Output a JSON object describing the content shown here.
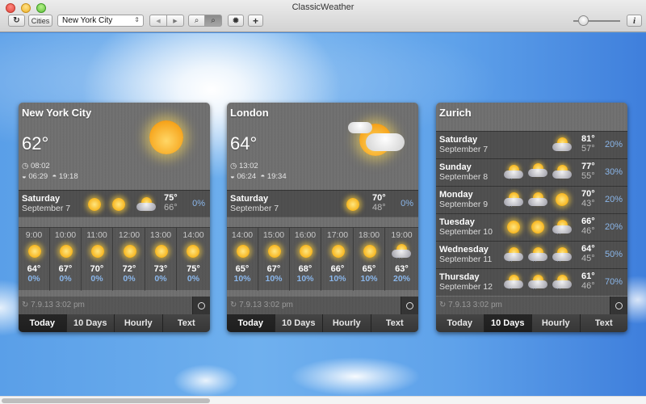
{
  "window": {
    "title": "ClassicWeather"
  },
  "toolbar": {
    "refresh_icon": "refresh-icon",
    "cities_label": "Cities",
    "city_select_value": "New York City",
    "back_icon": "◀",
    "forward_icon": "▶",
    "zoom_in_icon": "zoom-in-icon",
    "zoom_out_icon": "zoom-out-icon",
    "settings_icon": "gear-icon",
    "add_icon": "+",
    "info_icon": "i",
    "size_slider_value": 0.2
  },
  "widgets": [
    {
      "city": "New York City",
      "temp": "62°",
      "local_time": "08:02",
      "sunrise": "06:29",
      "sunset": "19:18",
      "condition_icon": "sunny-icon",
      "today": {
        "day": "Saturday",
        "date": "September 7",
        "hi": "75°",
        "lo": "66°",
        "precip": "0%",
        "icons": [
          "sunny",
          "sunny",
          "partly-cloudy"
        ]
      },
      "hourly": [
        {
          "time": "9:00",
          "temp": "64°",
          "precip": "0%",
          "icon": "sunny"
        },
        {
          "time": "10:00",
          "temp": "67°",
          "precip": "0%",
          "icon": "sunny"
        },
        {
          "time": "11:00",
          "temp": "70°",
          "precip": "0%",
          "icon": "sunny"
        },
        {
          "time": "12:00",
          "temp": "72°",
          "precip": "0%",
          "icon": "sunny"
        },
        {
          "time": "13:00",
          "temp": "73°",
          "precip": "0%",
          "icon": "sunny"
        },
        {
          "time": "14:00",
          "temp": "75°",
          "precip": "0%",
          "icon": "sunny"
        }
      ],
      "updated": "7.9.13 3:02 pm",
      "active_tab": "Today"
    },
    {
      "city": "London",
      "temp": "64°",
      "local_time": "13:02",
      "sunrise": "06:24",
      "sunset": "19:34",
      "condition_icon": "partly-cloudy-icon",
      "today": {
        "day": "Saturday",
        "date": "September 7",
        "hi": "70°",
        "lo": "48°",
        "precip": "0%",
        "icons": [
          "sunny"
        ]
      },
      "hourly": [
        {
          "time": "14:00",
          "temp": "65°",
          "precip": "10%",
          "icon": "sunny"
        },
        {
          "time": "15:00",
          "temp": "67°",
          "precip": "10%",
          "icon": "sunny"
        },
        {
          "time": "16:00",
          "temp": "68°",
          "precip": "10%",
          "icon": "sunny"
        },
        {
          "time": "17:00",
          "temp": "66°",
          "precip": "10%",
          "icon": "sunny"
        },
        {
          "time": "18:00",
          "temp": "65°",
          "precip": "10%",
          "icon": "sunny"
        },
        {
          "time": "19:00",
          "temp": "63°",
          "precip": "20%",
          "icon": "showers"
        }
      ],
      "updated": "7.9.13 3:02 pm",
      "active_tab": "Today"
    },
    {
      "city": "Zurich",
      "days": [
        {
          "day": "Saturday",
          "date": "September 7",
          "hi": "81°",
          "lo": "57°",
          "precip": "20%",
          "icons": [
            "showers"
          ]
        },
        {
          "day": "Sunday",
          "date": "September 8",
          "hi": "77°",
          "lo": "55°",
          "precip": "30%",
          "icons": [
            "showers",
            "partly-cloudy",
            "showers"
          ]
        },
        {
          "day": "Monday",
          "date": "September 9",
          "hi": "70°",
          "lo": "43°",
          "precip": "20%",
          "icons": [
            "showers",
            "partly-cloudy",
            "sunny"
          ]
        },
        {
          "day": "Tuesday",
          "date": "September 10",
          "hi": "66°",
          "lo": "46°",
          "precip": "20%",
          "icons": [
            "sunny",
            "sunny",
            "showers"
          ]
        },
        {
          "day": "Wednesday",
          "date": "September 11",
          "hi": "64°",
          "lo": "45°",
          "precip": "50%",
          "icons": [
            "showers",
            "showers",
            "showers"
          ]
        },
        {
          "day": "Thursday",
          "date": "September 12",
          "hi": "61°",
          "lo": "46°",
          "precip": "70%",
          "icons": [
            "showers",
            "showers",
            "showers"
          ]
        }
      ],
      "updated": "7.9.13 3:02 pm",
      "active_tab": "10 Days"
    }
  ],
  "tabs": [
    "Today",
    "10 Days",
    "Hourly",
    "Text"
  ],
  "colors": {
    "precip": "#8ab6ea",
    "sky": "#5a9fe8"
  }
}
